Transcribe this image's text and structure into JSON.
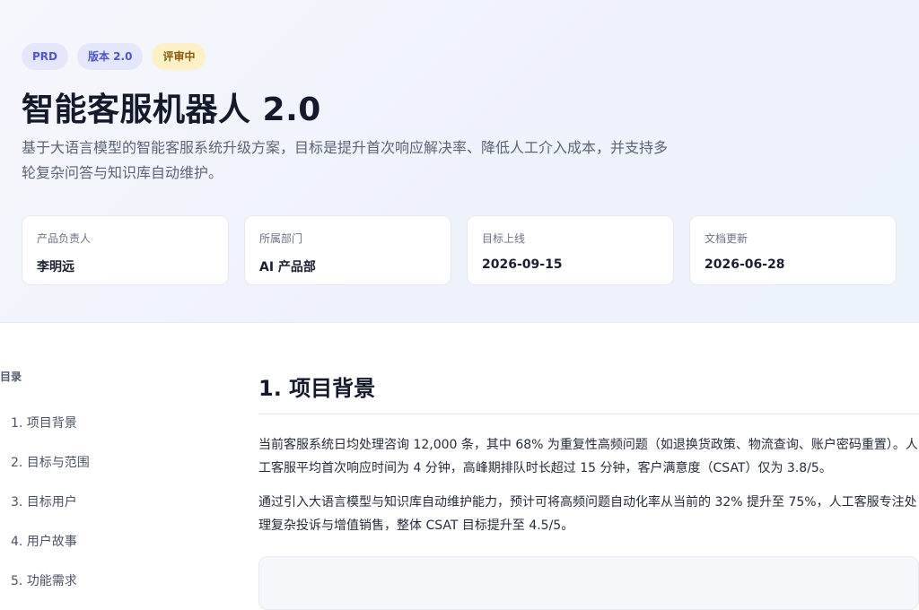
{
  "header": {
    "badges": [
      "PRD",
      "版本 2.0",
      "评审中"
    ],
    "title": "智能客服机器人 2.0",
    "subtitle": "基于大语言模型的智能客服系统升级方案，目标是提升首次响应解决率、降低人工介入成本，并支持多轮复杂问答与知识库自动维护。"
  },
  "meta_cards": [
    {
      "label": "产品负责人",
      "value": "李明远"
    },
    {
      "label": "所属部门",
      "value": "AI 产品部"
    },
    {
      "label": "目标上线",
      "value": "2026-09-15"
    },
    {
      "label": "文档更新",
      "value": "2026-06-28"
    }
  ],
  "toc": {
    "title": "目录",
    "items": [
      "1. 项目背景",
      "2. 目标与范围",
      "3. 目标用户",
      "4. 用户故事",
      "5. 功能需求"
    ]
  },
  "section": {
    "heading": "1. 项目背景",
    "paragraphs": [
      "当前客服系统日均处理咨询 12,000 条，其中 68% 为重复性高频问题（如退换货政策、物流查询、账户密码重置）。人工客服平均首次响应时间为 4 分钟，高峰期排队时长超过 15 分钟，客户满意度（CSAT）仅为 3.8/5。",
      "通过引入大语言模型与知识库自动维护能力，预计可将高频问题自动化率从当前的 32% 提升至 75%，人工客服专注处理复杂投诉与增值销售，整体 CSAT 目标提升至 4.5/5。"
    ]
  },
  "colors": {
    "accent": "#4f57c9",
    "badge_review_bg": "#fdf0c6",
    "badge_review_text": "#8a5a12"
  }
}
